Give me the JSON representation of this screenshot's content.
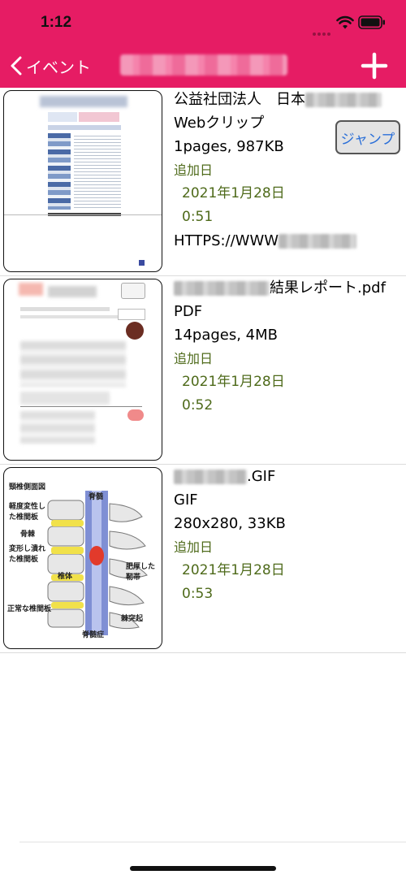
{
  "status_bar": {
    "time": "1:12"
  },
  "nav": {
    "back_label": "イベント"
  },
  "items": [
    {
      "title_prefix": "公益社団法人　日本",
      "type": "Webクリップ",
      "meta": "1pages, 987KB",
      "added_label": "追加日",
      "date": "2021年1月28日",
      "time": "0:51",
      "url_prefix": "HTTPS://WWW",
      "jump_label": "ジャンプ"
    },
    {
      "title_suffix": "結果レポート.pdf",
      "type": "PDF",
      "meta": "14pages, 4MB",
      "added_label": "追加日",
      "date": "2021年1月28日",
      "time": "0:52"
    },
    {
      "title_suffix": ".GIF",
      "type": "GIF",
      "meta": "280x280, 33KB",
      "added_label": "追加日",
      "date": "2021年1月28日",
      "time": "0:53",
      "figure_labels": {
        "heading": "頸椎側面図",
        "spinal_cord": "脊髄",
        "disc_degenerated": "軽度変性した椎間板",
        "bone_spur": "骨棘",
        "disc_crushed": "変形し潰れた椎間板",
        "vertebra": "椎体",
        "ligament": "肥厚した靭帯",
        "disc_normal": "正常な椎間板",
        "process": "棘突起",
        "stenosis": "脊髄症"
      }
    }
  ]
}
